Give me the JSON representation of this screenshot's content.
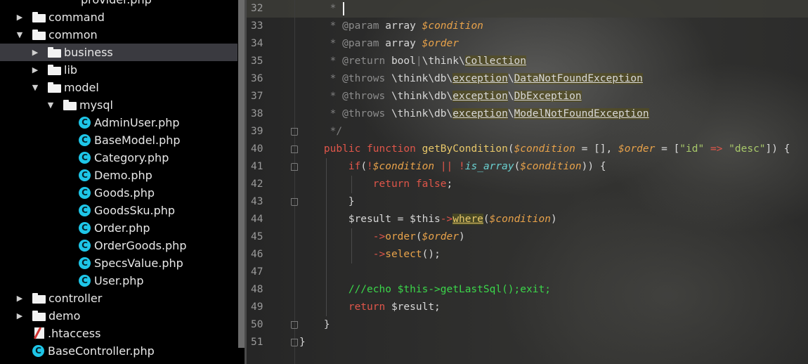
{
  "tree": {
    "items": [
      {
        "label": "provider.php",
        "kind": "php",
        "indent": 3,
        "arrow": "",
        "selected": false
      },
      {
        "label": "command",
        "kind": "folder",
        "indent": 1,
        "arrow": "▶",
        "selected": false
      },
      {
        "label": "common",
        "kind": "folder",
        "indent": 1,
        "arrow": "▼",
        "selected": false
      },
      {
        "label": "business",
        "kind": "folder",
        "indent": 2,
        "arrow": "▶",
        "selected": true
      },
      {
        "label": "lib",
        "kind": "folder",
        "indent": 2,
        "arrow": "▶",
        "selected": false
      },
      {
        "label": "model",
        "kind": "folder",
        "indent": 2,
        "arrow": "▼",
        "selected": false
      },
      {
        "label": "mysql",
        "kind": "folder",
        "indent": 3,
        "arrow": "▼",
        "selected": false
      },
      {
        "label": "AdminUser.php",
        "kind": "class",
        "indent": 4,
        "arrow": "",
        "selected": false
      },
      {
        "label": "BaseModel.php",
        "kind": "class",
        "indent": 4,
        "arrow": "",
        "selected": false
      },
      {
        "label": "Category.php",
        "kind": "class",
        "indent": 4,
        "arrow": "",
        "selected": false
      },
      {
        "label": "Demo.php",
        "kind": "class",
        "indent": 4,
        "arrow": "",
        "selected": false
      },
      {
        "label": "Goods.php",
        "kind": "class",
        "indent": 4,
        "arrow": "",
        "selected": false
      },
      {
        "label": "GoodsSku.php",
        "kind": "class",
        "indent": 4,
        "arrow": "",
        "selected": false
      },
      {
        "label": "Order.php",
        "kind": "class",
        "indent": 4,
        "arrow": "",
        "selected": false
      },
      {
        "label": "OrderGoods.php",
        "kind": "class",
        "indent": 4,
        "arrow": "",
        "selected": false
      },
      {
        "label": "SpecsValue.php",
        "kind": "class",
        "indent": 4,
        "arrow": "",
        "selected": false
      },
      {
        "label": "User.php",
        "kind": "class",
        "indent": 4,
        "arrow": "",
        "selected": false
      },
      {
        "label": "controller",
        "kind": "folder",
        "indent": 1,
        "arrow": "▶",
        "selected": false
      },
      {
        "label": "demo",
        "kind": "folder",
        "indent": 1,
        "arrow": "▶",
        "selected": false
      },
      {
        "label": ".htaccess",
        "kind": "htaccess",
        "indent": 1,
        "arrow": "",
        "selected": false
      },
      {
        "label": "BaseController.php",
        "kind": "class",
        "indent": 1,
        "arrow": "",
        "selected": false
      }
    ],
    "icon_glyphs": {
      "class": "C",
      "php": "PHP"
    }
  },
  "editor": {
    "lines": [
      {
        "n": "32",
        "fold": "",
        "tokens": [
          [
            "t-comment",
            "     * "
          ]
        ]
      },
      {
        "n": "33",
        "fold": "",
        "tokens": [
          [
            "t-comment",
            "     * "
          ],
          [
            "t-tag",
            "@param"
          ],
          [
            "t-type",
            " array "
          ],
          [
            "t-var",
            "$condition"
          ]
        ]
      },
      {
        "n": "34",
        "fold": "",
        "tokens": [
          [
            "t-comment",
            "     * "
          ],
          [
            "t-tag",
            "@param"
          ],
          [
            "t-type",
            " array "
          ],
          [
            "t-var",
            "$order"
          ]
        ]
      },
      {
        "n": "35",
        "fold": "",
        "tokens": [
          [
            "t-comment",
            "     * "
          ],
          [
            "t-tag",
            "@return"
          ],
          [
            "t-type",
            " bool"
          ],
          [
            "t-comment",
            "|"
          ],
          [
            "t-type",
            "\\think\\"
          ],
          [
            "t-ref",
            "Collection"
          ]
        ]
      },
      {
        "n": "36",
        "fold": "",
        "tokens": [
          [
            "t-comment",
            "     * "
          ],
          [
            "t-tag",
            "@throws"
          ],
          [
            "t-type",
            " \\think\\db\\"
          ],
          [
            "t-ref",
            "exception"
          ],
          [
            "t-type",
            "\\"
          ],
          [
            "t-ref",
            "DataNotFoundException"
          ]
        ]
      },
      {
        "n": "37",
        "fold": "",
        "tokens": [
          [
            "t-comment",
            "     * "
          ],
          [
            "t-tag",
            "@throws"
          ],
          [
            "t-type",
            " \\think\\db\\"
          ],
          [
            "t-ref",
            "exception"
          ],
          [
            "t-type",
            "\\"
          ],
          [
            "t-ref",
            "DbException"
          ]
        ]
      },
      {
        "n": "38",
        "fold": "",
        "tokens": [
          [
            "t-comment",
            "     * "
          ],
          [
            "t-tag",
            "@throws"
          ],
          [
            "t-type",
            " \\think\\db\\"
          ],
          [
            "t-ref",
            "exception"
          ],
          [
            "t-type",
            "\\"
          ],
          [
            "t-ref",
            "ModelNotFoundException"
          ]
        ]
      },
      {
        "n": "39",
        "fold": "end",
        "tokens": [
          [
            "t-comment",
            "     */"
          ]
        ]
      },
      {
        "n": "40",
        "fold": "start",
        "tokens": [
          [
            "t-kw",
            "    public function "
          ],
          [
            "t-fn",
            "getByCondition"
          ],
          [
            "t-plain",
            "("
          ],
          [
            "t-var",
            "$condition"
          ],
          [
            "t-plain",
            " = [], "
          ],
          [
            "t-var",
            "$order"
          ],
          [
            "t-plain",
            " = ["
          ],
          [
            "t-str",
            "\"id\""
          ],
          [
            "t-plain",
            " "
          ],
          [
            "t-kw",
            "=>"
          ],
          [
            "t-plain",
            " "
          ],
          [
            "t-str",
            "\"desc\""
          ],
          [
            "t-plain",
            "]) {"
          ]
        ]
      },
      {
        "n": "41",
        "fold": "start",
        "tokens": [
          [
            "t-kw",
            "        if"
          ],
          [
            "t-plain",
            "("
          ],
          [
            "t-kw",
            "!"
          ],
          [
            "t-var",
            "$condition"
          ],
          [
            "t-plain",
            " "
          ],
          [
            "t-kw",
            "||"
          ],
          [
            "t-plain",
            " "
          ],
          [
            "t-kw",
            "!"
          ],
          [
            "t-builtin",
            "is_array"
          ],
          [
            "t-plain",
            "("
          ],
          [
            "t-var",
            "$condition"
          ],
          [
            "t-plain",
            ")) {"
          ]
        ]
      },
      {
        "n": "42",
        "fold": "",
        "tokens": [
          [
            "t-kw",
            "            return false"
          ],
          [
            "t-plain",
            ";"
          ]
        ]
      },
      {
        "n": "43",
        "fold": "end",
        "tokens": [
          [
            "t-plain",
            "        }"
          ]
        ]
      },
      {
        "n": "44",
        "fold": "",
        "tokens": [
          [
            "t-plain",
            "        $result = $this"
          ],
          [
            "t-arrow",
            "->"
          ],
          [
            "t-where",
            "where"
          ],
          [
            "t-plain",
            "("
          ],
          [
            "t-var",
            "$condition"
          ],
          [
            "t-plain",
            ")"
          ]
        ]
      },
      {
        "n": "45",
        "fold": "",
        "tokens": [
          [
            "t-arrow",
            "            ->"
          ],
          [
            "t-method",
            "order"
          ],
          [
            "t-plain",
            "("
          ],
          [
            "t-var",
            "$order"
          ],
          [
            "t-plain",
            ")"
          ]
        ]
      },
      {
        "n": "46",
        "fold": "",
        "tokens": [
          [
            "t-arrow",
            "            ->"
          ],
          [
            "t-method",
            "select"
          ],
          [
            "t-plain",
            "();"
          ]
        ]
      },
      {
        "n": "47",
        "fold": "",
        "tokens": []
      },
      {
        "n": "48",
        "fold": "",
        "tokens": [
          [
            "t-green",
            "        ///echo $this->getLastSql();exit;"
          ]
        ]
      },
      {
        "n": "49",
        "fold": "",
        "tokens": [
          [
            "t-kw",
            "        return "
          ],
          [
            "t-plain",
            "$result;"
          ]
        ]
      },
      {
        "n": "50",
        "fold": "end",
        "tokens": [
          [
            "t-plain",
            "    }"
          ]
        ]
      },
      {
        "n": "51",
        "fold": "end",
        "tokens": [
          [
            "t-plain",
            "}"
          ]
        ]
      }
    ]
  }
}
